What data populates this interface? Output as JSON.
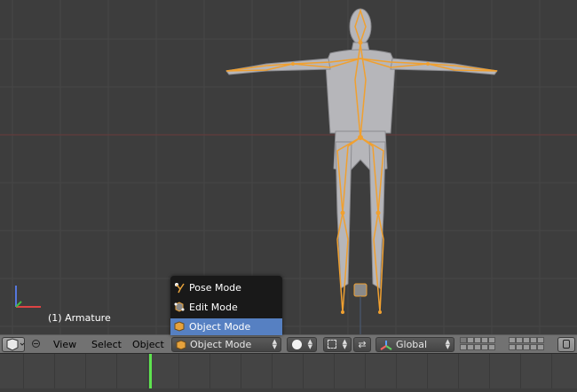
{
  "viewport": {
    "info_label": "(1) Armature",
    "colors": {
      "background": "#3d3d3d",
      "grid": "#474747",
      "x_axis": "#6b3a3a",
      "z_axis": "#4b5d7a",
      "armature": "#f0a030",
      "mesh": "#b8b8bc"
    }
  },
  "header": {
    "menu_view": "View",
    "menu_select": "Select",
    "menu_object": "Object",
    "mode_selected": "Object Mode",
    "transform_orientation": "Global"
  },
  "mode_menu": {
    "items": [
      {
        "label": "Pose Mode",
        "icon": "pose-mode-icon"
      },
      {
        "label": "Edit Mode",
        "icon": "edit-mode-icon"
      },
      {
        "label": "Object Mode",
        "icon": "object-mode-icon",
        "selected": true
      }
    ],
    "highlight_color": "#5680c2"
  },
  "timeline": {
    "current_frame_color": "#5ee34f"
  }
}
